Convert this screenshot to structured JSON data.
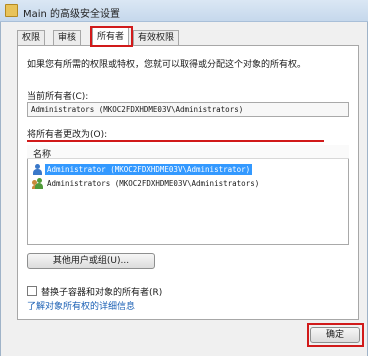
{
  "window": {
    "title": "Main 的高级安全设置"
  },
  "tabs": [
    "权限",
    "审核",
    "所有者",
    "有效权限"
  ],
  "owner": {
    "description": "如果您有所需的权限或特权，您就可以取得或分配这个对象的所有权。",
    "current_label": "当前所有者(C):",
    "current_value": "Administrators (MKOC2FDXHDME03V\\Administrators)",
    "change_label": "将所有者更改为(O):"
  },
  "list": {
    "column_header": "名称",
    "items": [
      {
        "text": "Administrator (MKOC2FDXHDME03V\\Administrator)",
        "icon": "user-icon",
        "selected": true
      },
      {
        "text": "Administrators (MKOC2FDXHDME03V\\Administrators)",
        "icon": "group-icon",
        "selected": false
      }
    ]
  },
  "buttons": {
    "other_users": "其他用户或组(U)...",
    "ok": "确定"
  },
  "options": {
    "replace_checkbox_label": "替换子容器和对象的所有者(R)",
    "replace_checked": false,
    "learn_more_link": "了解对象所有权的详细信息"
  },
  "colors": {
    "selection": "#3399ff",
    "highlight_annotation": "#d11a1a",
    "link": "#1a5fb4"
  }
}
